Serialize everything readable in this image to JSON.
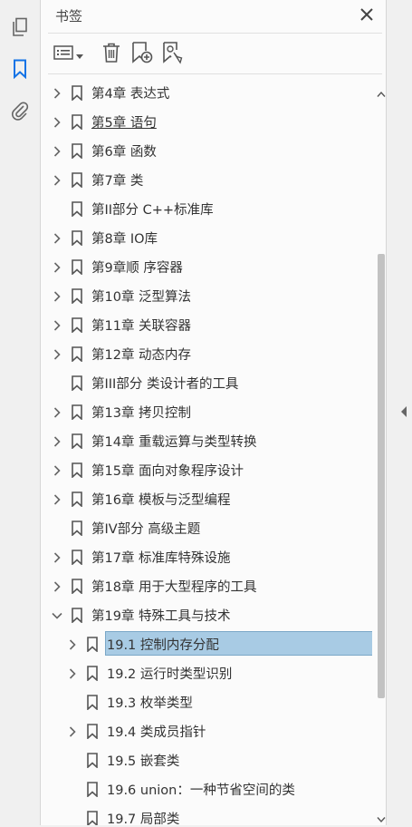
{
  "panel": {
    "title": "书签"
  },
  "bookmarks": [
    {
      "label": "第4章 表达式",
      "chevron": "right",
      "indent": 0
    },
    {
      "label": "第5章 语句",
      "chevron": "right",
      "indent": 0,
      "underline": true
    },
    {
      "label": "第6章 函数",
      "chevron": "right",
      "indent": 0
    },
    {
      "label": "第7章 类",
      "chevron": "right",
      "indent": 0
    },
    {
      "label": "第II部分 C++标准库",
      "chevron": "none",
      "indent": 0
    },
    {
      "label": "第8章 IO库",
      "chevron": "right",
      "indent": 0
    },
    {
      "label": "第9章顺 序容器",
      "chevron": "right",
      "indent": 0
    },
    {
      "label": "第10章 泛型算法",
      "chevron": "right",
      "indent": 0
    },
    {
      "label": "第11章 关联容器",
      "chevron": "right",
      "indent": 0
    },
    {
      "label": "第12章 动态内存",
      "chevron": "right",
      "indent": 0
    },
    {
      "label": "第III部分 类设计者的工具",
      "chevron": "none",
      "indent": 0
    },
    {
      "label": "第13章 拷贝控制",
      "chevron": "right",
      "indent": 0
    },
    {
      "label": "第14章 重载运算与类型转换",
      "chevron": "right",
      "indent": 0
    },
    {
      "label": "第15章 面向对象程序设计",
      "chevron": "right",
      "indent": 0
    },
    {
      "label": "第16章 模板与泛型编程",
      "chevron": "right",
      "indent": 0
    },
    {
      "label": "第IV部分 高级主题",
      "chevron": "none",
      "indent": 0
    },
    {
      "label": "第17章 标准库特殊设施",
      "chevron": "right",
      "indent": 0
    },
    {
      "label": "第18章 用于大型程序的工具",
      "chevron": "right",
      "indent": 0
    },
    {
      "label": "第19章 特殊工具与技术",
      "chevron": "down",
      "indent": 0
    },
    {
      "label": "19.1 控制内存分配",
      "chevron": "right",
      "indent": 1,
      "selected": true
    },
    {
      "label": "19.2 运行时类型识别",
      "chevron": "right",
      "indent": 1
    },
    {
      "label": "19.3 枚举类型",
      "chevron": "none",
      "indent": 1
    },
    {
      "label": "19.4 类成员指针",
      "chevron": "right",
      "indent": 1
    },
    {
      "label": "19.5 嵌套类",
      "chevron": "none",
      "indent": 1
    },
    {
      "label": "19.6 union：一种节省空间的类",
      "chevron": "none",
      "indent": 1
    },
    {
      "label": "19.7 局部类",
      "chevron": "none",
      "indent": 1
    }
  ],
  "icons": {
    "rail": [
      "pages-icon",
      "bookmark-icon",
      "attachment-icon"
    ],
    "toolbar": [
      "options-menu-icon",
      "trash-icon",
      "new-bookmark-icon",
      "bookmark-search-icon"
    ]
  },
  "colors": {
    "accent": "#1473e6",
    "selection": "#a8cbe4"
  }
}
